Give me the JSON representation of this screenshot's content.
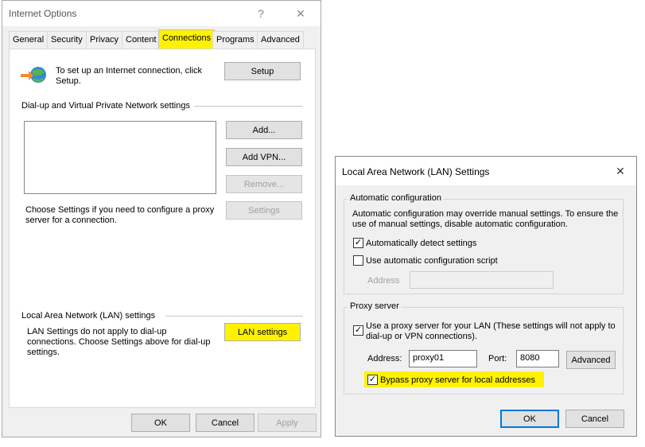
{
  "internet_options": {
    "title": "Internet Options",
    "help_glyph": "?",
    "close_glyph": "✕",
    "tabs": [
      "General",
      "Security",
      "Privacy",
      "Content",
      "Connections",
      "Programs",
      "Advanced"
    ],
    "setup_text": "To set up an Internet connection, click Setup.",
    "setup_button": "Setup",
    "dialup_heading": "Dial-up and Virtual Private Network settings",
    "add_button": "Add...",
    "add_vpn_button": "Add VPN...",
    "remove_button": "Remove...",
    "settings_text": "Choose Settings if you need to configure a proxy server for a connection.",
    "settings_button": "Settings",
    "lan_heading": "Local Area Network (LAN) settings",
    "lan_text": "LAN Settings do not apply to dial-up connections. Choose Settings above for dial-up settings.",
    "lan_settings_button": "LAN settings",
    "ok_button": "OK",
    "cancel_button": "Cancel",
    "apply_button": "Apply"
  },
  "lan_dialog": {
    "title": "Local Area Network (LAN) Settings",
    "close_glyph": "✕",
    "auto_config_group": "Automatic configuration",
    "auto_config_text": "Automatic configuration may override manual settings.  To ensure the use of manual settings, disable automatic configuration.",
    "auto_detect_label": "Automatically detect settings",
    "auto_detect_checked": true,
    "auto_script_label": "Use automatic configuration script",
    "auto_script_checked": false,
    "address_label": "Address",
    "address_value": "",
    "proxy_group": "Proxy server",
    "use_proxy_label": "Use a proxy server for your LAN (These settings will not apply to dial-up or VPN connections).",
    "use_proxy_checked": true,
    "proxy_address_label": "Address:",
    "proxy_address_value": "proxy01",
    "port_label": "Port:",
    "port_value": "8080",
    "advanced_button": "Advanced",
    "bypass_label": "Bypass proxy server for local addresses",
    "bypass_checked": true,
    "check_glyph": "✓",
    "ok_button": "OK",
    "cancel_button": "Cancel"
  },
  "colors": {
    "highlight": "#fff200",
    "default_button_border": "#0078d7"
  }
}
